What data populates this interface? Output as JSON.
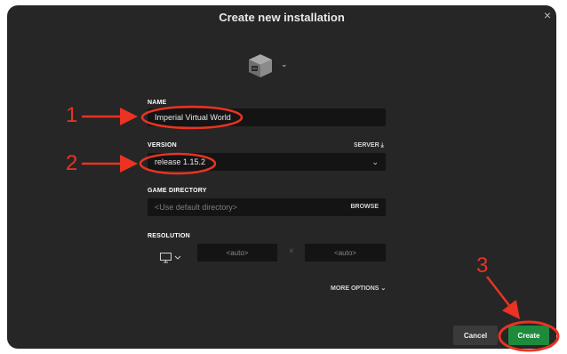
{
  "dialog": {
    "title": "Create new installation",
    "close_glyph": "×",
    "icon_name": "furnace-block-icon",
    "icon_chevron": "⌄"
  },
  "form": {
    "name_label": "NAME",
    "name_value": "Imperial Virtual World",
    "version_label": "VERSION",
    "server_link": "SERVER",
    "version_value": "release 1.15.2",
    "game_dir_label": "GAME DIRECTORY",
    "game_dir_placeholder": "<Use default directory>",
    "browse_label": "BROWSE",
    "resolution_label": "RESOLUTION",
    "resolution_width_placeholder": "<auto>",
    "resolution_height_placeholder": "<auto>",
    "resolution_separator": "×",
    "more_options_label": "MORE OPTIONS"
  },
  "buttons": {
    "cancel": "Cancel",
    "create": "Create"
  },
  "annotations": {
    "numbers": [
      "1",
      "2",
      "3"
    ],
    "color": "#ea3323"
  },
  "colors": {
    "window_bg": "#262626",
    "field_bg": "#141414",
    "create_green": "#1d8a3c"
  }
}
